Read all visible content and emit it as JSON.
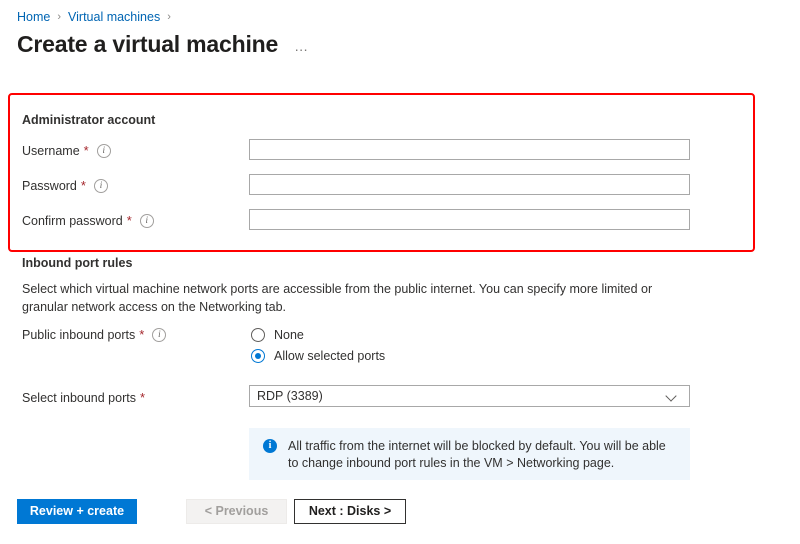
{
  "breadcrumb": {
    "items": [
      {
        "label": "Home"
      },
      {
        "label": "Virtual machines"
      }
    ],
    "separator": "›"
  },
  "header": {
    "title": "Create a virtual machine",
    "ellipsis": "…"
  },
  "admin_section": {
    "heading": "Administrator account",
    "highlight_color": "#ff0000",
    "fields": [
      {
        "label": "Username",
        "required_marker": "*",
        "info_icon": "info-circle-icon",
        "value": "",
        "placeholder": ""
      },
      {
        "label": "Password",
        "required_marker": "*",
        "info_icon": "info-circle-icon",
        "value": "",
        "placeholder": ""
      },
      {
        "label": "Confirm password",
        "required_marker": "*",
        "info_icon": "info-circle-icon",
        "value": "",
        "placeholder": ""
      }
    ]
  },
  "inbound_section": {
    "heading": "Inbound port rules",
    "description": "Select which virtual machine network ports are accessible from the public internet. You can specify more limited or granular network access on the Networking tab.",
    "public_ports_label": "Public inbound ports",
    "public_ports_required_marker": "*",
    "public_ports_info_icon": "info-circle-icon",
    "radio_options": [
      {
        "label": "None",
        "selected": false
      },
      {
        "label": "Allow selected ports",
        "selected": true
      }
    ],
    "select_ports_label": "Select inbound ports",
    "select_ports_required_marker": "*",
    "select_ports_value": "RDP (3389)",
    "select_ports_chevron": "chevron-down-icon",
    "banner": {
      "icon": "info-filled-icon",
      "text": "All traffic from the internet will be blocked by default. You will be able to change inbound port rules in the VM > Networking page.",
      "background": "#eff6fc"
    }
  },
  "footer": {
    "review_create_label": "Review + create",
    "previous_label": "< Previous",
    "next_label": "Next : Disks >",
    "primary_color": "#0078d4"
  }
}
